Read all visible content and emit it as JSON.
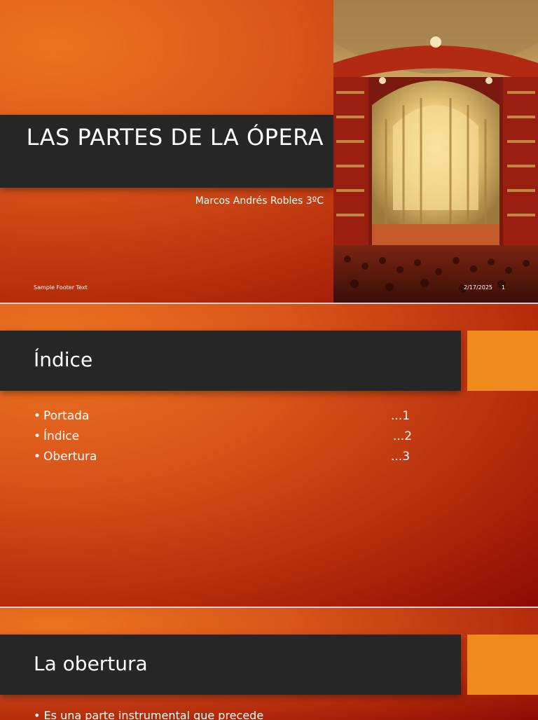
{
  "slide1": {
    "title": "LAS PARTES DE LA ÓPERA",
    "subtitle": "Marcos Andrés Robles 3ºC",
    "footer_text": "Sample Footer Text",
    "date": "2/17/2025",
    "slide_number": "1"
  },
  "slide2": {
    "title": "Índice",
    "items": [
      {
        "label": "Portada",
        "page": "...1"
      },
      {
        "label": "Índice",
        "page": "...2"
      },
      {
        "label": "Obertura",
        "page": "...3"
      }
    ]
  },
  "slide3": {
    "title": "La obertura",
    "bullet": "Es una parte instrumental que precede"
  },
  "colors": {
    "title_bar": "#262626",
    "accent": "#ef8b1c",
    "bg_light": "#ec7420",
    "bg_dark": "#8c0b04",
    "text": "#ffffff"
  }
}
